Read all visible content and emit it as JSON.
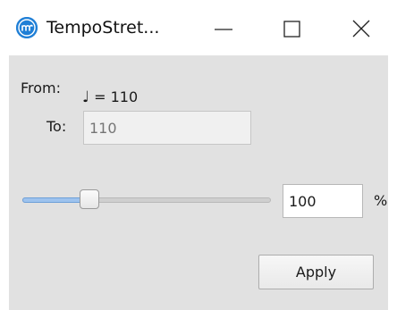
{
  "window": {
    "title": "TempoStret...",
    "app_icon": "musescore-logo-icon",
    "minimize_icon": "minimize-icon",
    "maximize_icon": "maximize-icon",
    "close_icon": "close-icon"
  },
  "form": {
    "from_label": "From:",
    "from_note_glyph": "♩",
    "from_value": " = 110",
    "to_label": "To:",
    "to_placeholder": "110",
    "to_value": "",
    "slider": {
      "value": 100,
      "fraction": 0.25
    },
    "percent_value": "100",
    "percent_unit": "%",
    "apply_label": "Apply"
  },
  "colors": {
    "accent": "#1f7fd6",
    "client_background": "#e1e1e1",
    "slider_fill": "#9ec3ee"
  }
}
